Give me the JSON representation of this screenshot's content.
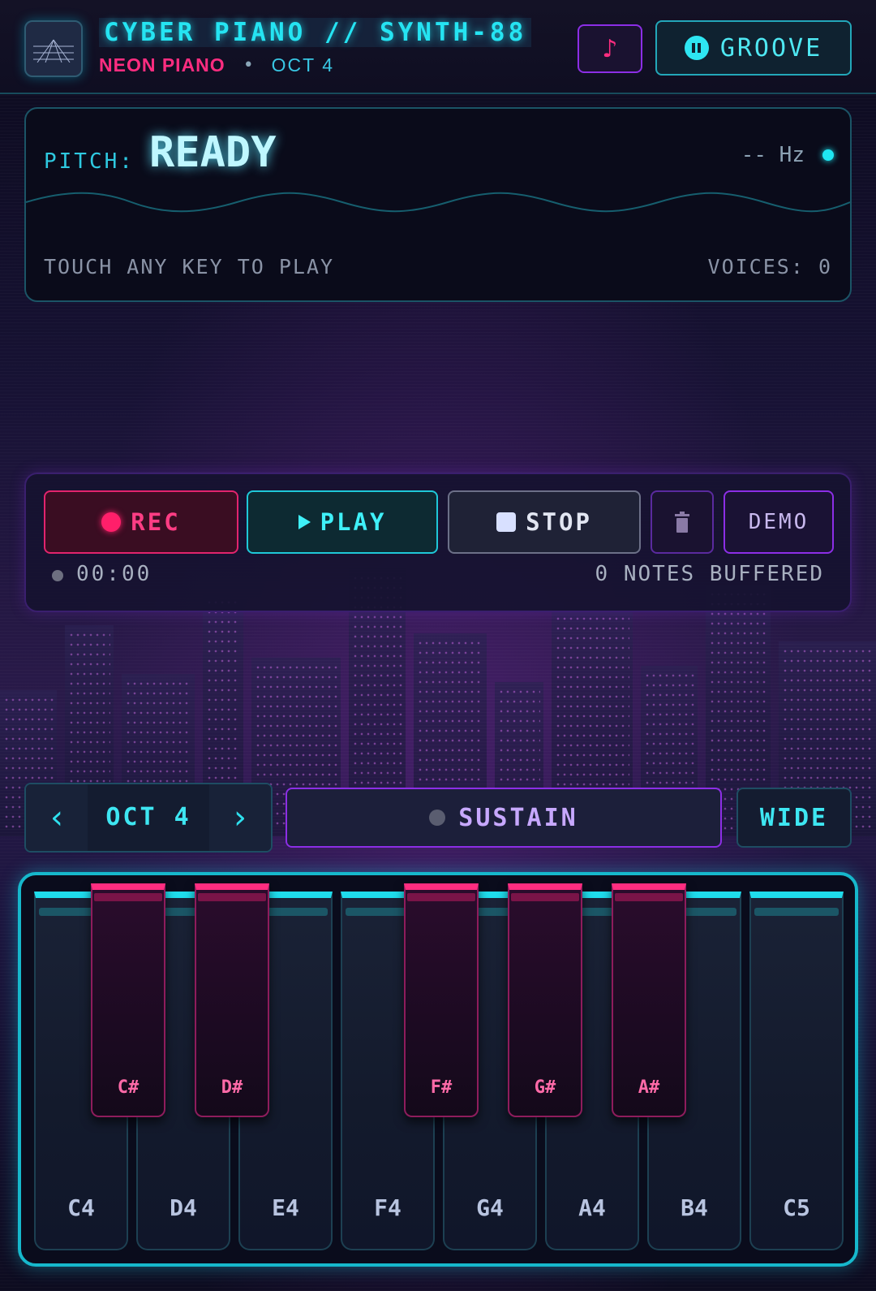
{
  "header": {
    "title": "CYBER PIANO // SYNTH-88",
    "brand": "NEON PIANO",
    "separator": "•",
    "octave": "OCT 4",
    "note_button_icon": "music-note-icon",
    "groove_label": "GROOVE",
    "groove_icon": "pause-circle-icon"
  },
  "pitch": {
    "label": "PITCH:",
    "value": "READY",
    "hz": "-- Hz",
    "hint": "TOUCH ANY KEY TO PLAY",
    "voices": "VOICES: 0"
  },
  "transport": {
    "rec_label": "REC",
    "play_label": "PLAY",
    "stop_label": "STOP",
    "trash_icon": "trash-icon",
    "demo_label": "DEMO",
    "time": "00:00",
    "buffered": "0 NOTES BUFFERED"
  },
  "controls": {
    "octave_label": "OCT 4",
    "prev_icon": "chevron-left-icon",
    "next_icon": "chevron-right-icon",
    "sustain_label": "SUSTAIN",
    "wide_label": "WIDE"
  },
  "keyboard": {
    "white_keys": [
      "C4",
      "D4",
      "E4",
      "F4",
      "G4",
      "A4",
      "B4",
      "C5"
    ],
    "black_keys": [
      "C#",
      "D#",
      "F#",
      "G#",
      "A#"
    ]
  },
  "colors": {
    "cyan": "#25e4f2",
    "magenta": "#ff2d80",
    "purple": "#8c2ee6",
    "background": "#0c0a1f"
  }
}
